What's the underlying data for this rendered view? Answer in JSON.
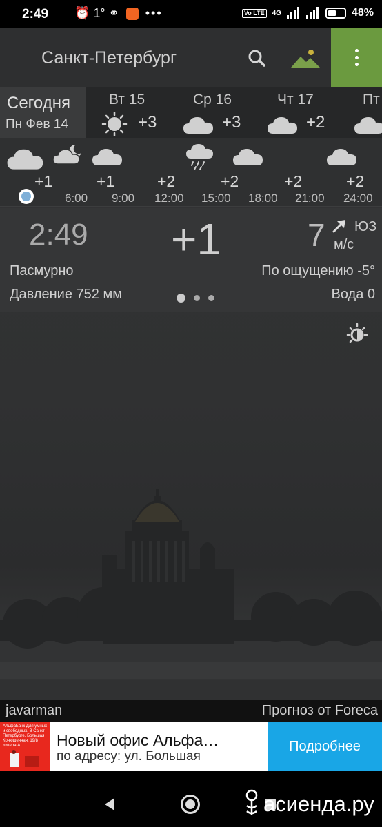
{
  "status_bar": {
    "time": "2:49",
    "notif_icons": "⏰ 1° ⚭",
    "network": "4G",
    "volte": "Vo LTE",
    "battery_percent": 48,
    "battery_label": "48%"
  },
  "header": {
    "city": "Санкт-Петербург",
    "icons": [
      "search-icon",
      "landscape-icon",
      "more-vertical-icon"
    ],
    "menu_color": "#6b9a3f"
  },
  "days": {
    "today": {
      "name": "Сегодня",
      "date": "Пн Фев 14"
    },
    "items": [
      {
        "name": "Вт 15",
        "temp": "+3",
        "icon": "sun-icon"
      },
      {
        "name": "Ср 16",
        "temp": "+3",
        "icon": "cloud-icon"
      },
      {
        "name": "Чт 17",
        "temp": "+2",
        "icon": "cloud-icon"
      },
      {
        "name": "Пт",
        "temp": "",
        "icon": "cloud-icon"
      }
    ]
  },
  "hourly": {
    "temps": [
      "+1",
      "+1",
      "+2",
      "+2",
      "+2",
      "+2"
    ],
    "times": [
      "6:00",
      "9:00",
      "12:00",
      "15:00",
      "18:00",
      "21:00",
      "24:00"
    ],
    "icons": [
      "cloud-icon",
      "moon-cloud-icon",
      "cloud-icon",
      "rain-cloud-icon",
      "cloud-icon",
      "cloud-icon"
    ]
  },
  "current": {
    "time": "2:49",
    "temp": "+1",
    "wind_speed": "7",
    "wind_dir": "ЮЗ",
    "wind_unit": "м/с",
    "condition": "Пасмурно",
    "feels_like": "По ощущению -5°",
    "pressure": "Давление 752 мм",
    "water": "Вода 0"
  },
  "footer": {
    "author": "javarman",
    "source": "Прогноз от Foreca"
  },
  "ad": {
    "image_text": "АльфаБанк Для умных и свободных. В Санкт-Петербурге, Большая Конюшенная, 19/8 литера А",
    "title": "Новый офис Альфа…",
    "subtitle": "по адресу: ул. Большая",
    "button": "Подробнее",
    "button_color": "#19a6e6"
  },
  "nav": {
    "watermark": "асиенда.ру"
  }
}
